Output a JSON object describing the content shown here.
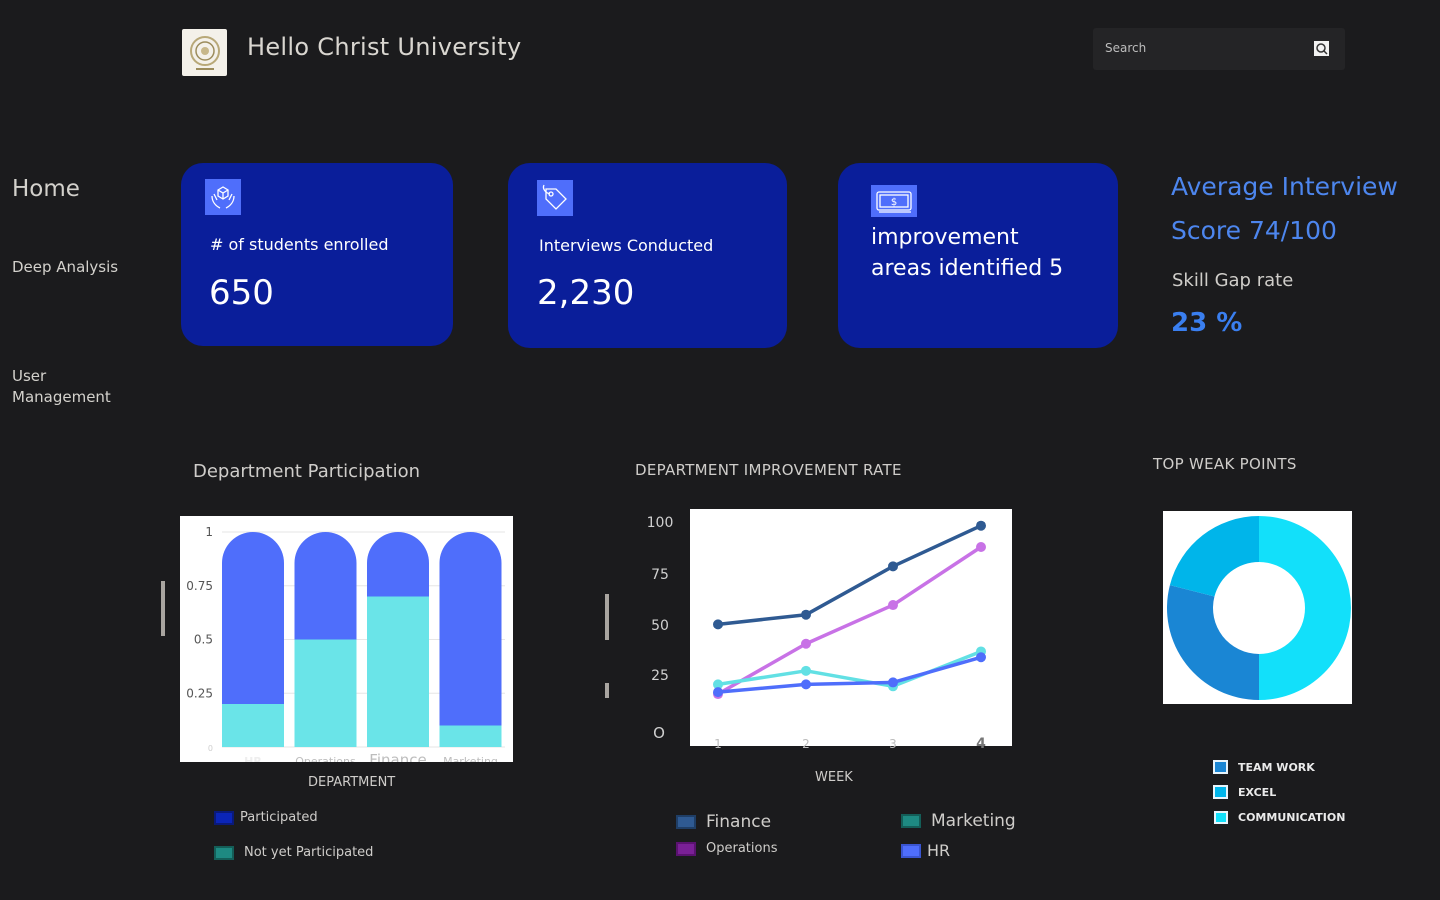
{
  "header": {
    "title": "Hello Christ University",
    "search_placeholder": "Search"
  },
  "icons": {
    "logo": "university-seal-icon",
    "search": "search-icon",
    "students": "hands-box-icon",
    "interviews": "tag-icon",
    "improvement": "money-bill-icon"
  },
  "sidebar": {
    "items": [
      {
        "label": "Home"
      },
      {
        "label": "Deep Analysis"
      },
      {
        "label": "User Management"
      }
    ]
  },
  "cards": [
    {
      "label": "# of students enrolled",
      "value": "650"
    },
    {
      "label": "Interviews Conducted",
      "value": "2,230"
    },
    {
      "label": "improvement areas identified 5"
    }
  ],
  "stats": {
    "avg_score": "Average Interview Score 74/100",
    "skill_gap_label": "Skill Gap rate",
    "skill_gap_value": "23 %"
  },
  "colors": {
    "background": "#1b1b1d",
    "card": "#0a1e9a",
    "accent_blue": "#4d86ee",
    "participated": "#4f6efb",
    "not_participated": "#6ae4e8",
    "finance": "#2f5a92",
    "operations": "#c872e6",
    "marketing": "#62e0e4",
    "hr": "#4f6efb",
    "teamwork": "#1a86d4",
    "excel": "#00b5ea",
    "communication": "#12e0fa"
  },
  "chart_data": [
    {
      "type": "bar",
      "title": "Department Participation",
      "xlabel": "DEPARTMENT",
      "ylabel": "",
      "categories": [
        "HR",
        "Operations",
        "Finance",
        "Marketing"
      ],
      "stacked": true,
      "ylim": [
        0,
        1
      ],
      "yticks": [
        "0",
        "0.25",
        "0.5",
        "0.75",
        "1"
      ],
      "series": [
        {
          "name": "Not yet Participated",
          "values": [
            0.2,
            0.5,
            0.7,
            0.1
          ]
        },
        {
          "name": "Participated",
          "values": [
            0.8,
            0.5,
            0.3,
            0.9
          ]
        }
      ]
    },
    {
      "type": "line",
      "title": "DEPARTMENT IMPROVEMENT RATE",
      "xlabel": "WEEK",
      "ylabel": "",
      "x": [
        "1",
        "2",
        "3",
        "4"
      ],
      "ylim": [
        0,
        100
      ],
      "yticks": [
        "O",
        "25",
        "50",
        "75",
        "100"
      ],
      "series": [
        {
          "name": "Finance",
          "values": [
            52,
            57,
            82,
            103
          ]
        },
        {
          "name": "Operations",
          "values": [
            16,
            42,
            62,
            92
          ]
        },
        {
          "name": "Marketing",
          "values": [
            21,
            28,
            20,
            38
          ]
        },
        {
          "name": "HR",
          "values": [
            17,
            21,
            22,
            35
          ]
        }
      ]
    },
    {
      "type": "pie",
      "title": "TOP WEAK POINTS",
      "donut": true,
      "labels": [
        "TEAM WORK",
        "EXCEL",
        "COMMUNICATION"
      ],
      "values": [
        29,
        21,
        50
      ]
    }
  ]
}
